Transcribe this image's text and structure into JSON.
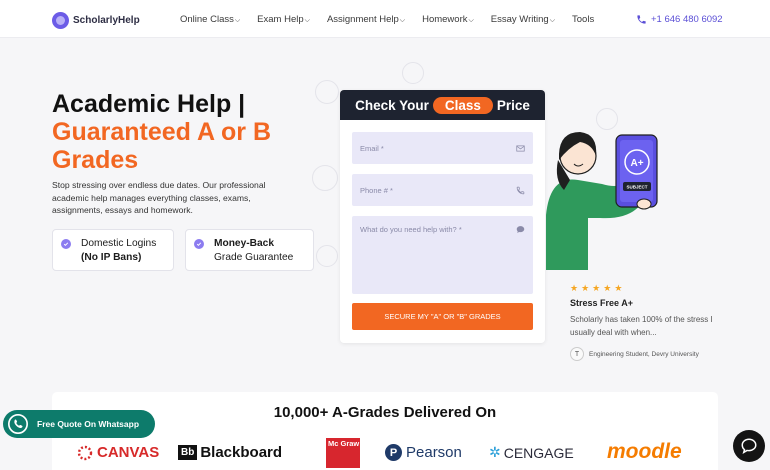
{
  "header": {
    "logo": "ScholarlyHelp",
    "nav": [
      {
        "label": "Online Class",
        "chevron": true
      },
      {
        "label": "Exam Help",
        "chevron": true
      },
      {
        "label": "Assignment Help",
        "chevron": true
      },
      {
        "label": "Homework",
        "chevron": true
      },
      {
        "label": "Essay Writing",
        "chevron": true
      },
      {
        "label": "Tools",
        "chevron": false
      }
    ],
    "phone": "+1 646 480 6092"
  },
  "hero": {
    "title_line1": "Academic Help |",
    "title_line2": "Guaranteed A or B",
    "title_line3": "Grades",
    "description": "Stop stressing over endless due dates. Our professional academic help manages everything classes, exams, assignments, essays and homework.",
    "badges": [
      {
        "line1": "Domestic Logins",
        "line2": "(No IP Bans)"
      },
      {
        "line1": "Money-Back",
        "line2": "Grade Guarantee"
      }
    ]
  },
  "form": {
    "title_pre": "Check Your",
    "title_pill": "Class",
    "title_post": "Price",
    "email_placeholder": "Email *",
    "phone_placeholder": "Phone # *",
    "message_placeholder": "What do you need help with? *",
    "submit_label": "SECURE MY \"A\" OR \"B\" GRADES"
  },
  "illustration": {
    "badge_text": "SUBJECT",
    "grade": "A+"
  },
  "testimonial": {
    "stars": 5,
    "title": "Stress Free A+",
    "text": "Scholarly has taken 100% of the stress I usually deal with when...",
    "avatar_initial": "T",
    "author": "Engineering Student, Devry University"
  },
  "delivered": {
    "title": "10,000+ A-Grades Delivered On",
    "logos": [
      "CANVAS",
      "Blackboard",
      "Mc Graw Hill",
      "Pearson",
      "CENGAGE",
      "moodle"
    ]
  },
  "whatsapp": {
    "label": "Free Quote On Whatsapp"
  },
  "colors": {
    "accent": "#f26722",
    "brand": "#6c5ce7",
    "dark": "#1e2330",
    "whatsapp": "#0d7b6b"
  }
}
